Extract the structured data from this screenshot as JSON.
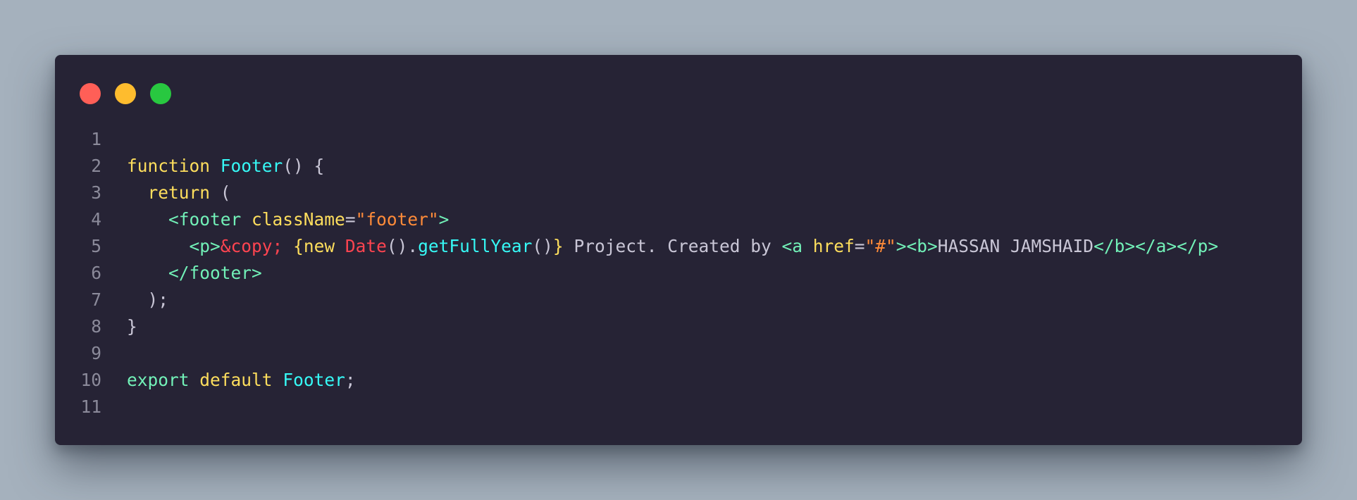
{
  "window": {
    "traffic_lights": [
      {
        "name": "close",
        "color": "#ff5f57"
      },
      {
        "name": "minimize",
        "color": "#febc2e"
      },
      {
        "name": "maximize",
        "color": "#28c840"
      }
    ]
  },
  "colors": {
    "background": "#a5b1bd",
    "window": "#262335",
    "line_number": "#8b8a9a",
    "plain": "#c9c6d6",
    "keyword": "#fede5d",
    "identifier": "#36f9f6",
    "tag": "#72f1b8",
    "string": "#ff8b39",
    "entity": "#fe4450",
    "class_name": "#fe4450",
    "brace": "#fede5d"
  },
  "editor": {
    "lines": [
      {
        "number": "1",
        "tokens": []
      },
      {
        "number": "2",
        "tokens": [
          {
            "text": "function",
            "type": "keyword"
          },
          {
            "text": " ",
            "type": "plain"
          },
          {
            "text": "Footer",
            "type": "identifier"
          },
          {
            "text": "() {",
            "type": "plain"
          }
        ]
      },
      {
        "number": "3",
        "tokens": [
          {
            "text": "  ",
            "type": "plain"
          },
          {
            "text": "return",
            "type": "keyword"
          },
          {
            "text": " (",
            "type": "plain"
          }
        ]
      },
      {
        "number": "4",
        "tokens": [
          {
            "text": "    ",
            "type": "plain"
          },
          {
            "text": "<footer",
            "type": "tag"
          },
          {
            "text": " ",
            "type": "plain"
          },
          {
            "text": "className",
            "type": "keyword"
          },
          {
            "text": "=",
            "type": "plain"
          },
          {
            "text": "\"footer\"",
            "type": "string"
          },
          {
            "text": ">",
            "type": "tag"
          }
        ]
      },
      {
        "number": "5",
        "tokens": [
          {
            "text": "      ",
            "type": "plain"
          },
          {
            "text": "<p>",
            "type": "tag"
          },
          {
            "text": "&copy;",
            "type": "entity"
          },
          {
            "text": " ",
            "type": "plain"
          },
          {
            "text": "{",
            "type": "brace"
          },
          {
            "text": "new",
            "type": "keyword"
          },
          {
            "text": " ",
            "type": "plain"
          },
          {
            "text": "Date",
            "type": "class_name"
          },
          {
            "text": "().",
            "type": "plain"
          },
          {
            "text": "getFullYear",
            "type": "identifier"
          },
          {
            "text": "()",
            "type": "plain"
          },
          {
            "text": "}",
            "type": "brace"
          },
          {
            "text": " Project. Created by ",
            "type": "plain"
          },
          {
            "text": "<a",
            "type": "tag"
          },
          {
            "text": " ",
            "type": "plain"
          },
          {
            "text": "href",
            "type": "keyword"
          },
          {
            "text": "=",
            "type": "plain"
          },
          {
            "text": "\"#\"",
            "type": "string"
          },
          {
            "text": "><b>",
            "type": "tag"
          },
          {
            "text": "HASSAN JAMSHAID",
            "type": "plain"
          },
          {
            "text": "</b></a></p>",
            "type": "tag"
          }
        ]
      },
      {
        "number": "6",
        "tokens": [
          {
            "text": "    ",
            "type": "plain"
          },
          {
            "text": "</footer>",
            "type": "tag"
          }
        ]
      },
      {
        "number": "7",
        "tokens": [
          {
            "text": "  );",
            "type": "plain"
          }
        ]
      },
      {
        "number": "8",
        "tokens": [
          {
            "text": "}",
            "type": "plain"
          }
        ]
      },
      {
        "number": "9",
        "tokens": []
      },
      {
        "number": "10",
        "tokens": [
          {
            "text": "export",
            "type": "tag"
          },
          {
            "text": " ",
            "type": "plain"
          },
          {
            "text": "default",
            "type": "keyword"
          },
          {
            "text": " ",
            "type": "plain"
          },
          {
            "text": "Footer",
            "type": "identifier"
          },
          {
            "text": ";",
            "type": "plain"
          }
        ]
      },
      {
        "number": "11",
        "tokens": []
      }
    ]
  }
}
